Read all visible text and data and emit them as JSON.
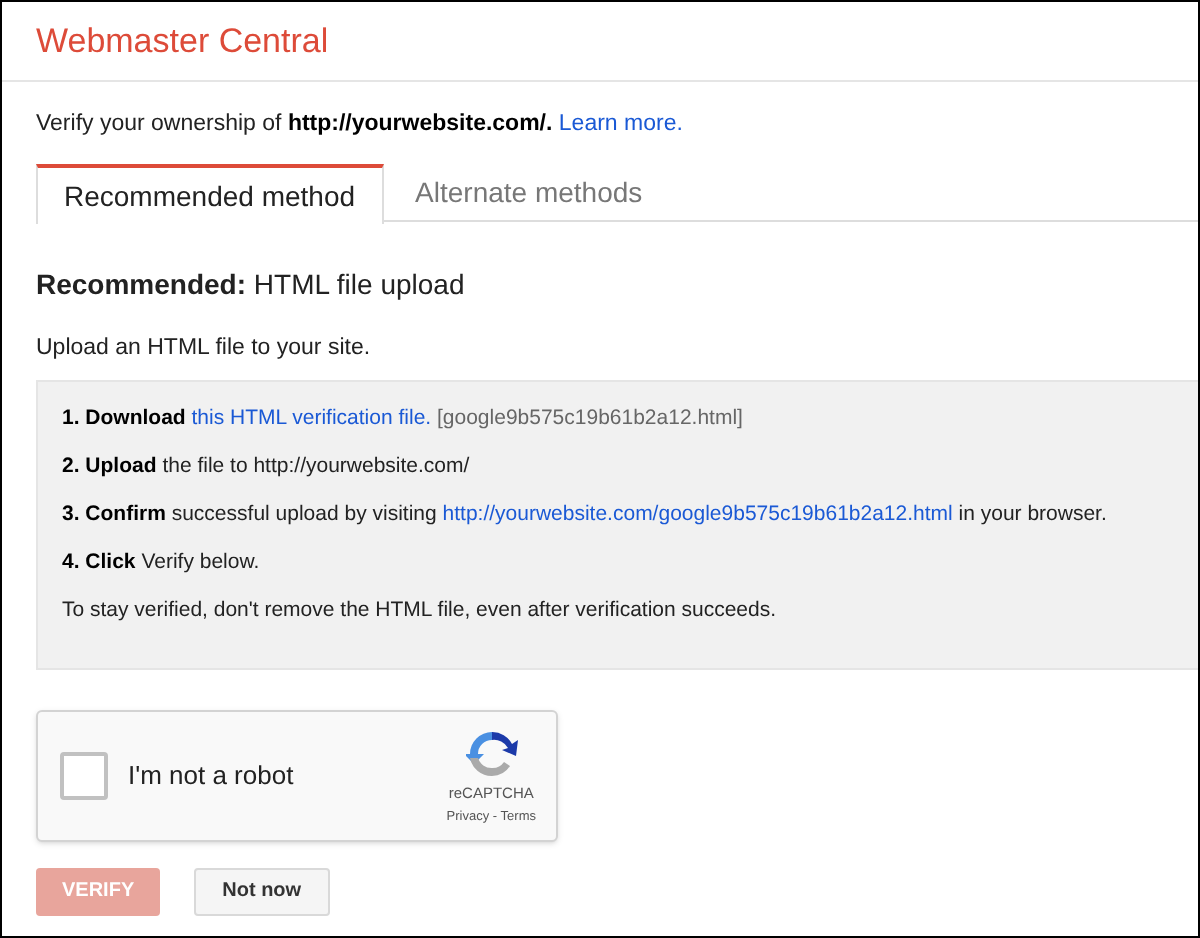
{
  "header": {
    "title": "Webmaster Central"
  },
  "intro": [
    {
      "kind": "text",
      "text": "Verify your ownership of"
    },
    {
      "kind": "bold",
      "text": "http://yourwebsite.com/."
    },
    {
      "kind": "link",
      "text": "Learn more."
    }
  ],
  "tabs": [
    {
      "label": "Recommended method",
      "selected": true
    },
    {
      "label": "Alternate methods",
      "selected": false
    }
  ],
  "heading": {
    "label": "Recommended:",
    "value": "HTML file upload"
  },
  "subtitle": "Upload an HTML file to your site.",
  "steps": [
    [
      {
        "kind": "bold",
        "text": "1. Download"
      },
      {
        "kind": "link",
        "text": "this HTML verification file."
      },
      {
        "kind": "muted",
        "text": "[google9b575c19b61b2a12.html]"
      }
    ],
    [
      {
        "kind": "bold",
        "text": "2. Upload"
      },
      {
        "kind": "text",
        "text": "the file to http://yourwebsite.com/"
      }
    ],
    [
      {
        "kind": "bold",
        "text": "3. Confirm"
      },
      {
        "kind": "text",
        "text": "successful upload by visiting"
      },
      {
        "kind": "link",
        "text": "http://yourwebsite.com/google9b575c19b61b2a12.html"
      },
      {
        "kind": "text",
        "text": "in your browser."
      }
    ],
    [
      {
        "kind": "bold",
        "text": "4. Click"
      },
      {
        "kind": "text",
        "text": "Verify below."
      }
    ],
    [
      {
        "kind": "text",
        "text": "To stay verified, don't remove the HTML file, even after verification succeeds."
      }
    ]
  ],
  "captcha": {
    "label": "I'm not a robot",
    "checked": false,
    "brand": "reCAPTCHA",
    "privacy": "Privacy",
    "separator": "-",
    "terms": "Terms"
  },
  "buttons": [
    {
      "label": "VERIFY",
      "kind": "primary",
      "disabled": true
    },
    {
      "label": "Not now",
      "kind": "secondary",
      "disabled": false
    }
  ]
}
